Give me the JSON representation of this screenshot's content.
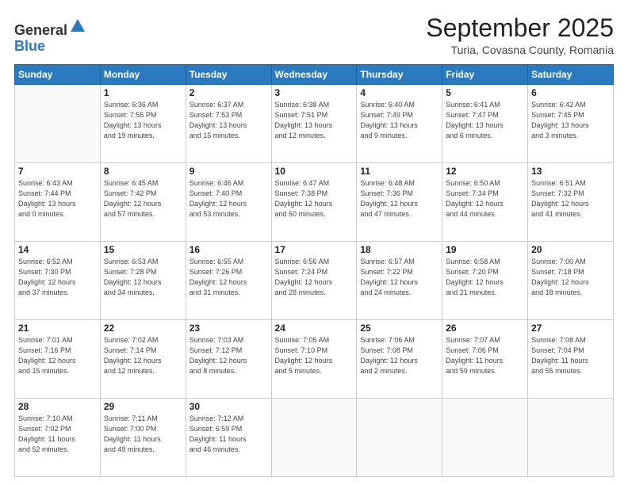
{
  "header": {
    "logo_line1": "General",
    "logo_line2": "Blue",
    "month_title": "September 2025",
    "subtitle": "Turia, Covasna County, Romania"
  },
  "weekdays": [
    "Sunday",
    "Monday",
    "Tuesday",
    "Wednesday",
    "Thursday",
    "Friday",
    "Saturday"
  ],
  "weeks": [
    [
      {
        "day": "",
        "info": ""
      },
      {
        "day": "1",
        "info": "Sunrise: 6:36 AM\nSunset: 7:55 PM\nDaylight: 13 hours\nand 19 minutes."
      },
      {
        "day": "2",
        "info": "Sunrise: 6:37 AM\nSunset: 7:53 PM\nDaylight: 13 hours\nand 15 minutes."
      },
      {
        "day": "3",
        "info": "Sunrise: 6:38 AM\nSunset: 7:51 PM\nDaylight: 13 hours\nand 12 minutes."
      },
      {
        "day": "4",
        "info": "Sunrise: 6:40 AM\nSunset: 7:49 PM\nDaylight: 13 hours\nand 9 minutes."
      },
      {
        "day": "5",
        "info": "Sunrise: 6:41 AM\nSunset: 7:47 PM\nDaylight: 13 hours\nand 6 minutes."
      },
      {
        "day": "6",
        "info": "Sunrise: 6:42 AM\nSunset: 7:45 PM\nDaylight: 13 hours\nand 3 minutes."
      }
    ],
    [
      {
        "day": "7",
        "info": "Sunrise: 6:43 AM\nSunset: 7:44 PM\nDaylight: 13 hours\nand 0 minutes."
      },
      {
        "day": "8",
        "info": "Sunrise: 6:45 AM\nSunset: 7:42 PM\nDaylight: 12 hours\nand 57 minutes."
      },
      {
        "day": "9",
        "info": "Sunrise: 6:46 AM\nSunset: 7:40 PM\nDaylight: 12 hours\nand 53 minutes."
      },
      {
        "day": "10",
        "info": "Sunrise: 6:47 AM\nSunset: 7:38 PM\nDaylight: 12 hours\nand 50 minutes."
      },
      {
        "day": "11",
        "info": "Sunrise: 6:48 AM\nSunset: 7:36 PM\nDaylight: 12 hours\nand 47 minutes."
      },
      {
        "day": "12",
        "info": "Sunrise: 6:50 AM\nSunset: 7:34 PM\nDaylight: 12 hours\nand 44 minutes."
      },
      {
        "day": "13",
        "info": "Sunrise: 6:51 AM\nSunset: 7:32 PM\nDaylight: 12 hours\nand 41 minutes."
      }
    ],
    [
      {
        "day": "14",
        "info": "Sunrise: 6:52 AM\nSunset: 7:30 PM\nDaylight: 12 hours\nand 37 minutes."
      },
      {
        "day": "15",
        "info": "Sunrise: 6:53 AM\nSunset: 7:28 PM\nDaylight: 12 hours\nand 34 minutes."
      },
      {
        "day": "16",
        "info": "Sunrise: 6:55 AM\nSunset: 7:26 PM\nDaylight: 12 hours\nand 31 minutes."
      },
      {
        "day": "17",
        "info": "Sunrise: 6:56 AM\nSunset: 7:24 PM\nDaylight: 12 hours\nand 28 minutes."
      },
      {
        "day": "18",
        "info": "Sunrise: 6:57 AM\nSunset: 7:22 PM\nDaylight: 12 hours\nand 24 minutes."
      },
      {
        "day": "19",
        "info": "Sunrise: 6:58 AM\nSunset: 7:20 PM\nDaylight: 12 hours\nand 21 minutes."
      },
      {
        "day": "20",
        "info": "Sunrise: 7:00 AM\nSunset: 7:18 PM\nDaylight: 12 hours\nand 18 minutes."
      }
    ],
    [
      {
        "day": "21",
        "info": "Sunrise: 7:01 AM\nSunset: 7:16 PM\nDaylight: 12 hours\nand 15 minutes."
      },
      {
        "day": "22",
        "info": "Sunrise: 7:02 AM\nSunset: 7:14 PM\nDaylight: 12 hours\nand 12 minutes."
      },
      {
        "day": "23",
        "info": "Sunrise: 7:03 AM\nSunset: 7:12 PM\nDaylight: 12 hours\nand 8 minutes."
      },
      {
        "day": "24",
        "info": "Sunrise: 7:05 AM\nSunset: 7:10 PM\nDaylight: 12 hours\nand 5 minutes."
      },
      {
        "day": "25",
        "info": "Sunrise: 7:06 AM\nSunset: 7:08 PM\nDaylight: 12 hours\nand 2 minutes."
      },
      {
        "day": "26",
        "info": "Sunrise: 7:07 AM\nSunset: 7:06 PM\nDaylight: 11 hours\nand 59 minutes."
      },
      {
        "day": "27",
        "info": "Sunrise: 7:08 AM\nSunset: 7:04 PM\nDaylight: 11 hours\nand 55 minutes."
      }
    ],
    [
      {
        "day": "28",
        "info": "Sunrise: 7:10 AM\nSunset: 7:02 PM\nDaylight: 11 hours\nand 52 minutes."
      },
      {
        "day": "29",
        "info": "Sunrise: 7:11 AM\nSunset: 7:00 PM\nDaylight: 11 hours\nand 49 minutes."
      },
      {
        "day": "30",
        "info": "Sunrise: 7:12 AM\nSunset: 6:59 PM\nDaylight: 11 hours\nand 46 minutes."
      },
      {
        "day": "",
        "info": ""
      },
      {
        "day": "",
        "info": ""
      },
      {
        "day": "",
        "info": ""
      },
      {
        "day": "",
        "info": ""
      }
    ]
  ]
}
